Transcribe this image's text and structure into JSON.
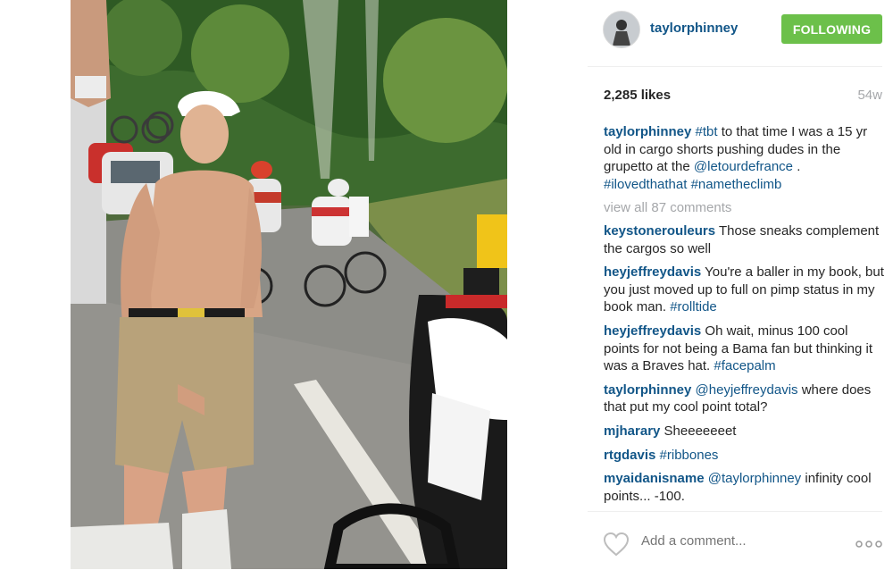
{
  "post": {
    "username": "taylorphinney",
    "follow_label": "FOLLOWING",
    "likes": "2,285 likes",
    "time_ago": "54w"
  },
  "caption": {
    "user": "taylorphinney",
    "tag1": "#tbt",
    "text1": " to that time I was a 15 yr old in cargo shorts pushing dudes in the grupetto at the ",
    "mention": "@letourdefrance",
    "text2": " . ",
    "tag2": "#ilovedthathat",
    "tag3": "#nametheсlimb"
  },
  "view_all": "view all 87 comments",
  "comments": [
    {
      "user": "keystonerouleurs",
      "text": " Those sneaks complement the cargos so well"
    },
    {
      "user": "heyjeffreydavis",
      "text": " You're a baller in my book, but you just moved up to full on pimp status in my book man. ",
      "tag": "#rolltide"
    },
    {
      "user": "heyjeffreydavis",
      "text": " Oh wait, minus 100 cool points for not being a Bama fan but thinking it was a Braves hat. ",
      "tag": "#facepalm"
    },
    {
      "user": "taylorphinney",
      "mention": "@heyjeffreydavis",
      "text": " where does that put my cool point total?"
    },
    {
      "user": "mjharary",
      "text": " Sheeeeeeet"
    },
    {
      "user": "rtgdavis",
      "tag": "#ribbones"
    },
    {
      "user": "myaidanisname",
      "mention": "@taylorphinney",
      "text": " infinity cool points... -100."
    }
  ],
  "footer": {
    "add_comment_placeholder": "Add a comment..."
  },
  "icons": {
    "like": "heart-icon",
    "more": "more-options-icon"
  },
  "colors": {
    "link": "#125688",
    "follow_bg": "#6cc04a",
    "muted": "#a5a7aa"
  }
}
